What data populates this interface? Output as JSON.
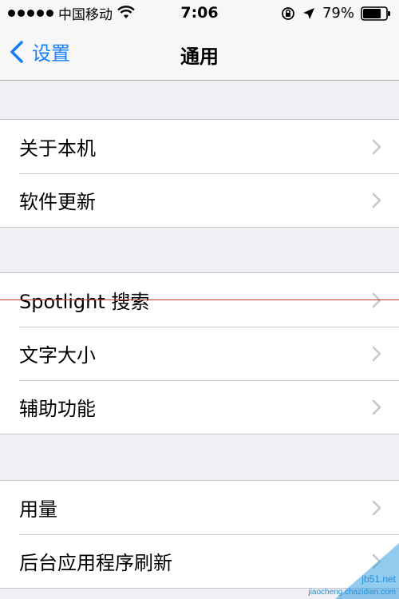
{
  "status_bar": {
    "carrier": "中国移动",
    "time": "7:06",
    "battery_percent": "79%",
    "battery_level": 0.79,
    "icons": [
      "signal-dots-icon",
      "wifi-icon",
      "rotation-lock-icon",
      "location-icon",
      "battery-icon"
    ]
  },
  "nav": {
    "back_label": "设置",
    "title": "通用"
  },
  "groups": [
    {
      "items": [
        {
          "label": "关于本机"
        },
        {
          "label": "软件更新"
        }
      ]
    },
    {
      "items": [
        {
          "label": "Spotlight 搜索"
        },
        {
          "label": "文字大小"
        },
        {
          "label": "辅助功能"
        }
      ]
    },
    {
      "items": [
        {
          "label": "用量"
        },
        {
          "label": "后台应用程序刷新"
        }
      ]
    }
  ],
  "watermark": {
    "text": "jb51.net",
    "sub": "jiaocheng.chazidian.com"
  },
  "colors": {
    "accent": "#157efb",
    "background": "#efeff4",
    "separator": "#c8c7cc",
    "chevron": "#c7c7cc"
  }
}
